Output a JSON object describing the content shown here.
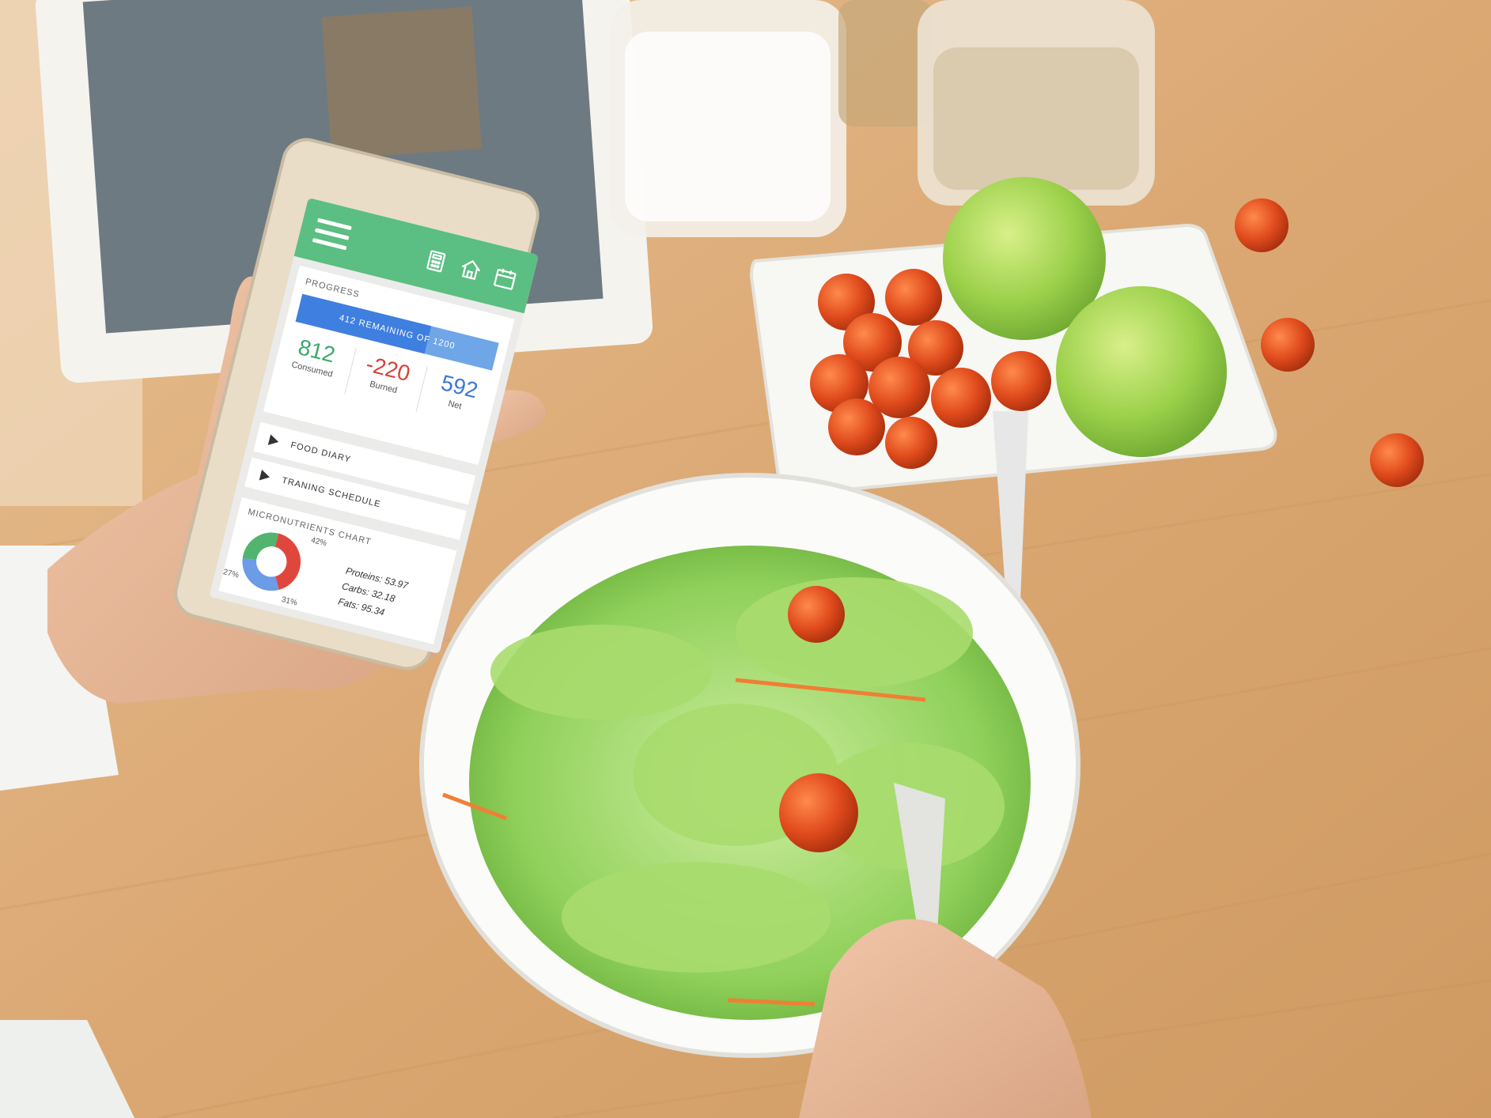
{
  "app": {
    "header": {
      "icons": [
        "menu-icon",
        "calculator-icon",
        "home-icon",
        "calendar-icon"
      ],
      "color": "#5bbe82"
    },
    "progress": {
      "label": "PROGRESS",
      "bar_text": "412 REMAINING OF 1200",
      "remaining": 412,
      "goal": 1200,
      "stats": [
        {
          "value": "812",
          "label": "Consumed",
          "color": "#3aa968"
        },
        {
          "value": "-220",
          "label": "Burned",
          "color": "#d9413a"
        },
        {
          "value": "592",
          "label": "Net",
          "color": "#3b78d8"
        }
      ]
    },
    "menu_rows": [
      {
        "label": "FOOD DIARY"
      },
      {
        "label": "TRANING SCHEDULE"
      }
    ],
    "micronutrients": {
      "label": "MICRONUTRIENTS CHART",
      "slices": [
        {
          "pct": 42,
          "label": "42%",
          "color": "#e0473c"
        },
        {
          "pct": 31,
          "label": "31%",
          "color": "#6c9be8"
        },
        {
          "pct": 27,
          "label": "27%",
          "color": "#52b46e"
        }
      ],
      "macros": [
        "Proteins: 53.97",
        "Carbs: 32.18",
        "Fats: 95.34"
      ]
    }
  }
}
